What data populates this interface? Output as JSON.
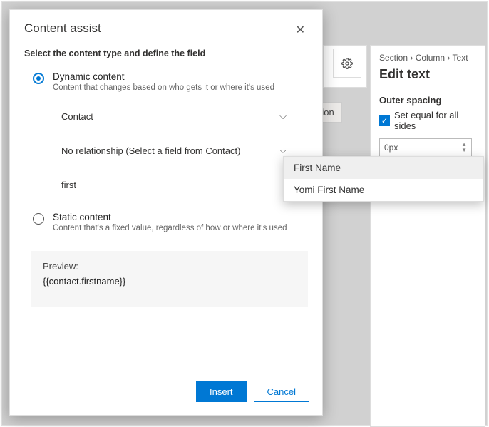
{
  "dialog": {
    "title": "Content assist",
    "subtitle": "Select the content type and define the field",
    "dynamic": {
      "title": "Dynamic content",
      "desc": "Content that changes based on who gets it or where it's used",
      "entity": "Contact",
      "relationship": "No relationship (Select a field from Contact)",
      "search_value": "first"
    },
    "static": {
      "title": "Static content",
      "desc": "Content that's a fixed value, regardless of how or where it's used"
    },
    "preview": {
      "label": "Preview:",
      "value": "{{contact.firstname}}"
    },
    "buttons": {
      "insert": "Insert",
      "cancel": "Cancel"
    }
  },
  "autocomplete": {
    "items": [
      "First Name",
      "Yomi First Name"
    ]
  },
  "rightpanel": {
    "breadcrumb": [
      "Section",
      "Column",
      "Text"
    ],
    "title": "Edit text",
    "section": "Outer spacing",
    "checkbox_label": "Set equal for all sides",
    "spacing_value": "0px"
  },
  "background": {
    "tab_label_fragment": "zation"
  }
}
